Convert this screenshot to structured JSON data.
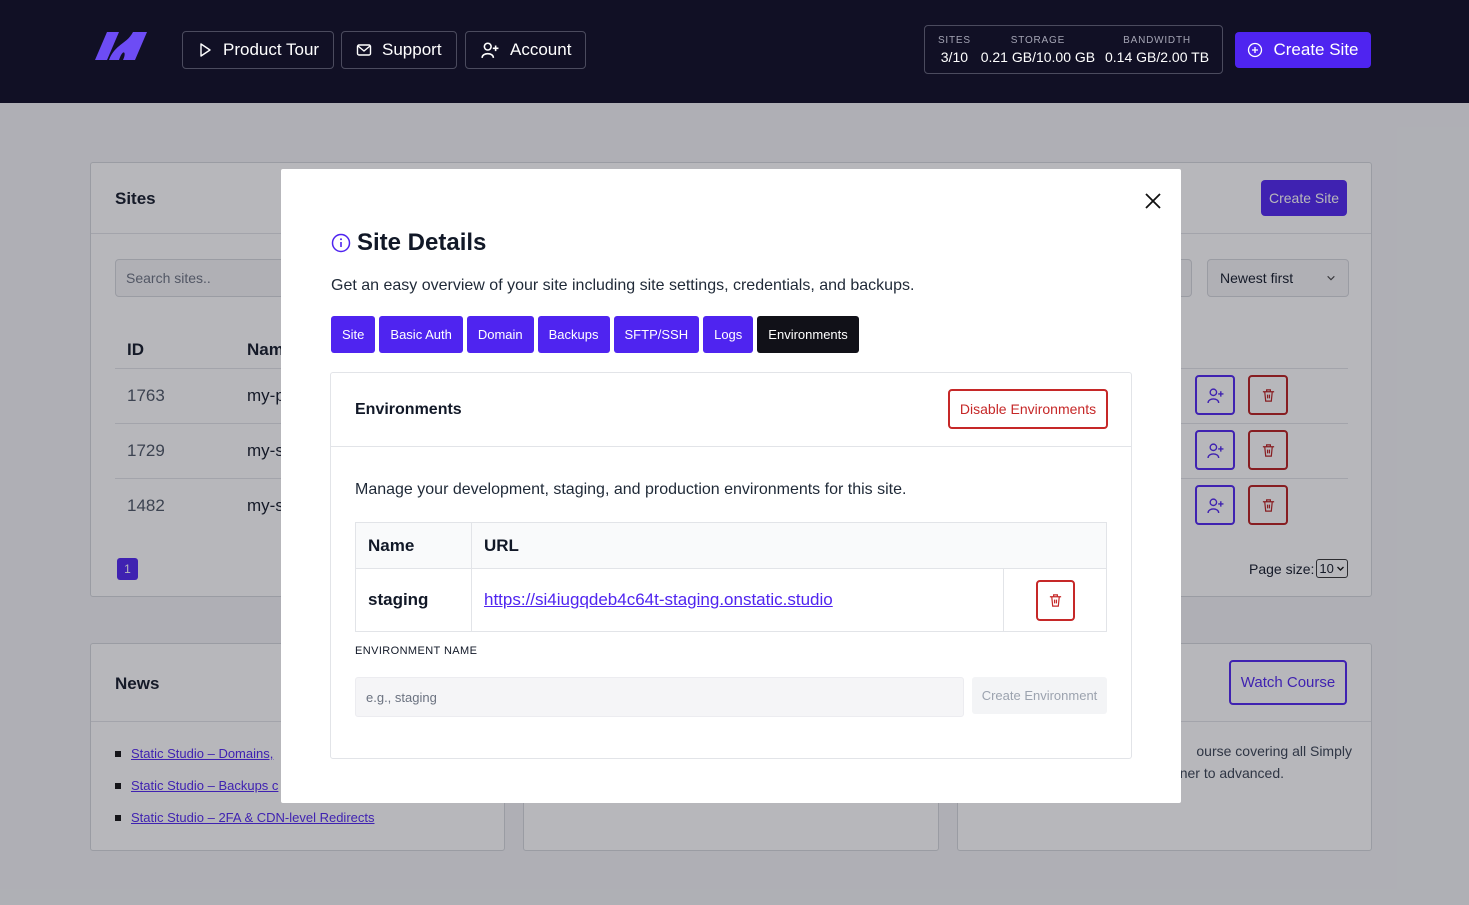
{
  "header": {
    "nav": [
      {
        "label": "Product Tour",
        "icon": "play-icon"
      },
      {
        "label": "Support",
        "icon": "mail-icon"
      },
      {
        "label": "Account",
        "icon": "user-plus-icon"
      }
    ],
    "stats": [
      {
        "label": "SITES",
        "value": "3/10"
      },
      {
        "label": "STORAGE",
        "value": "0.21 GB/10.00 GB"
      },
      {
        "label": "BANDWIDTH",
        "value": "0.14 GB/2.00 TB"
      }
    ],
    "create_label": "Create Site"
  },
  "sites": {
    "title": "Sites",
    "create_label": "Create Site",
    "search_placeholder": "Search sites..",
    "sort_value": "Newest first",
    "columns": {
      "id": "ID",
      "name": "Nam"
    },
    "rows": [
      {
        "id": "1763",
        "name": "my-p"
      },
      {
        "id": "1729",
        "name": "my-s"
      },
      {
        "id": "1482",
        "name": "my-s"
      }
    ],
    "page": "1",
    "page_size_label": "Page size:",
    "page_size_value": "10"
  },
  "news": {
    "title": "News",
    "items": [
      "Static Studio – Domains,",
      "Static Studio – Backups c",
      "Static Studio – 2FA & CDN-level Redirects"
    ]
  },
  "course": {
    "watch_label": "Watch Course",
    "text_line1": "ourse covering all Simply",
    "text_line2": "inner to advanced."
  },
  "modal": {
    "title": "Site Details",
    "subtitle": "Get an easy overview of your site including site settings, credentials, and backups.",
    "tabs": [
      "Site",
      "Basic Auth",
      "Domain",
      "Backups",
      "SFTP/SSH",
      "Logs",
      "Environments"
    ],
    "active_tab": "Environments",
    "environments": {
      "title": "Environments",
      "disable_label": "Disable Environments",
      "description": "Manage your development, staging, and production environments for this site.",
      "columns": {
        "name": "Name",
        "url": "URL"
      },
      "rows": [
        {
          "name": "staging",
          "url": "https://si4iugqdeb4c64t-staging.onstatic.studio"
        }
      ],
      "field_label": "ENVIRONMENT NAME",
      "field_placeholder": "e.g., staging",
      "create_label": "Create Environment"
    }
  },
  "colors": {
    "accent": "#4f24f0",
    "header_bg": "#111025",
    "danger": "#c62828"
  }
}
